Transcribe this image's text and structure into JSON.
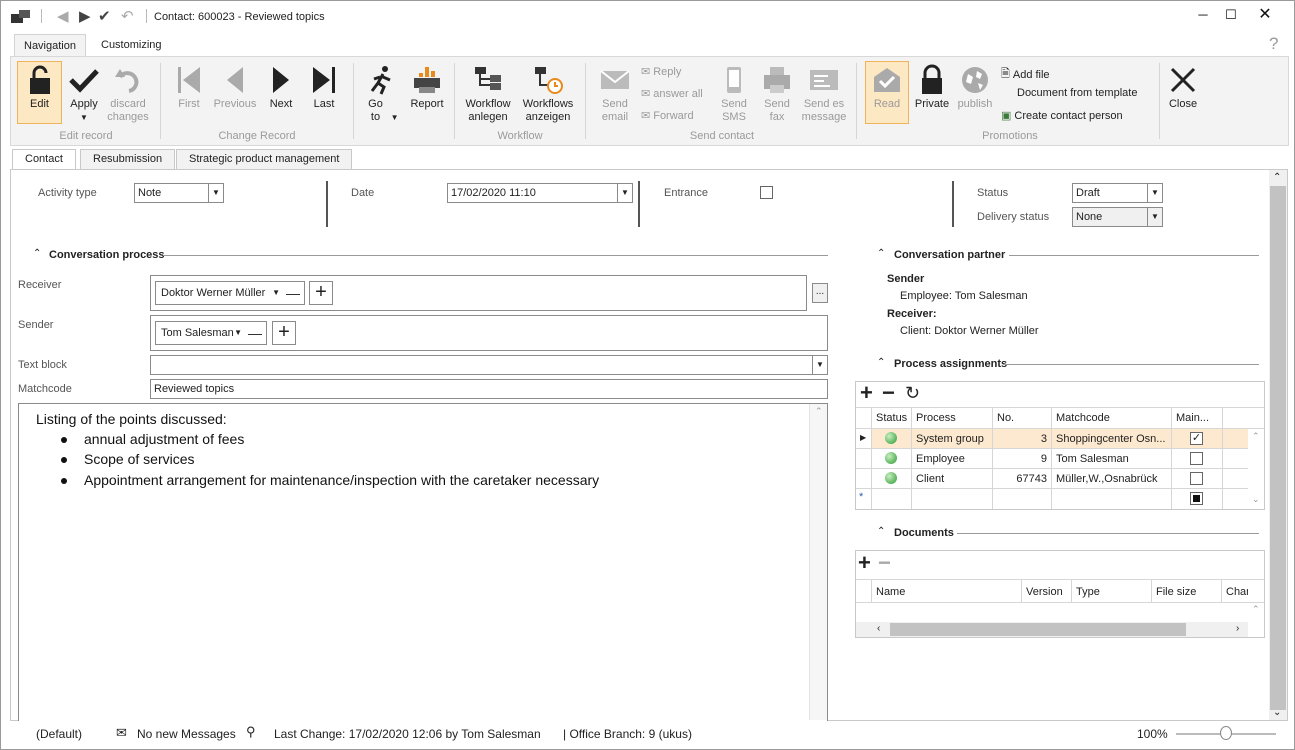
{
  "window": {
    "title": "Contact: 600023 - Reviewed topics"
  },
  "ribbon_tabs": [
    "Navigation",
    "Customizing"
  ],
  "ribbon": {
    "edit": "Edit",
    "apply": "Apply",
    "discard": "discard changes",
    "first": "First",
    "previous": "Previous",
    "next": "Next",
    "last": "Last",
    "goto": "Go to",
    "report": "Report",
    "wf_anlegen": "Workflow anlegen",
    "wf_anzeigen": "Workflows anzeigen",
    "send_email": "Send email",
    "reply": "Reply",
    "answer_all": "answer all",
    "forward": "Forward",
    "send_sms": "Send SMS",
    "send_fax": "Send fax",
    "send_es": "Send es message",
    "read": "Read",
    "private": "Private",
    "publish": "publish",
    "add_file": "Add file",
    "doc_template": "Document from template",
    "create_contact": "Create contact person",
    "close": "Close",
    "groups": {
      "edit_record": "Edit record",
      "change_record": "Change Record",
      "workflow": "Workflow",
      "send_contact": "Send contact",
      "promotions": "Promotions"
    }
  },
  "doc_tabs": [
    "Contact",
    "Resubmission",
    "Strategic product management"
  ],
  "header_fields": {
    "activity_type_label": "Activity type",
    "activity_type": "Note",
    "date_label": "Date",
    "date": "17/02/2020 11:10",
    "entrance_label": "Entrance",
    "status_label": "Status",
    "status": "Draft",
    "delivery_label": "Delivery status",
    "delivery": "None"
  },
  "conversation": {
    "title": "Conversation process",
    "receiver_label": "Receiver",
    "receiver": "Doktor Werner Müller",
    "sender_label": "Sender",
    "sender": "Tom Salesman",
    "textblock_label": "Text block",
    "matchcode_label": "Matchcode",
    "matchcode": "Reviewed topics",
    "ellipsis": "...",
    "body_intro": "Listing of the points discussed:",
    "body_items": [
      "annual adjustment of fees",
      "Scope of services",
      "Appointment arrangement for maintenance/inspection with the caretaker necessary"
    ]
  },
  "partner": {
    "title": "Conversation partner",
    "sender_h": "Sender",
    "sender_v": "Employee: Tom Salesman",
    "receiver_h": "Receiver:",
    "receiver_v": "Client: Doktor Werner Müller"
  },
  "process": {
    "title": "Process assignments",
    "headers": [
      "Status",
      "Process",
      "No.",
      "Matchcode",
      "Main..."
    ],
    "rows": [
      {
        "process": "System group",
        "no": "3",
        "matchcode": "Shoppingcenter Osn...",
        "main": true
      },
      {
        "process": "Employee",
        "no": "9",
        "matchcode": "Tom Salesman",
        "main": false
      },
      {
        "process": "Client",
        "no": "67743",
        "matchcode": "Müller,W.,Osnabrück",
        "main": false
      }
    ]
  },
  "documents": {
    "title": "Documents",
    "headers": [
      "Name",
      "Version",
      "Type",
      "File size",
      "Chan"
    ]
  },
  "statusbar": {
    "profile": "(Default)",
    "messages": "No new Messages",
    "last_change": "Last Change: 17/02/2020 12:06 by Tom Salesman",
    "branch": "| Office Branch:  9 (ukus)",
    "zoom": "100%",
    "zoom_level": 0.5
  }
}
